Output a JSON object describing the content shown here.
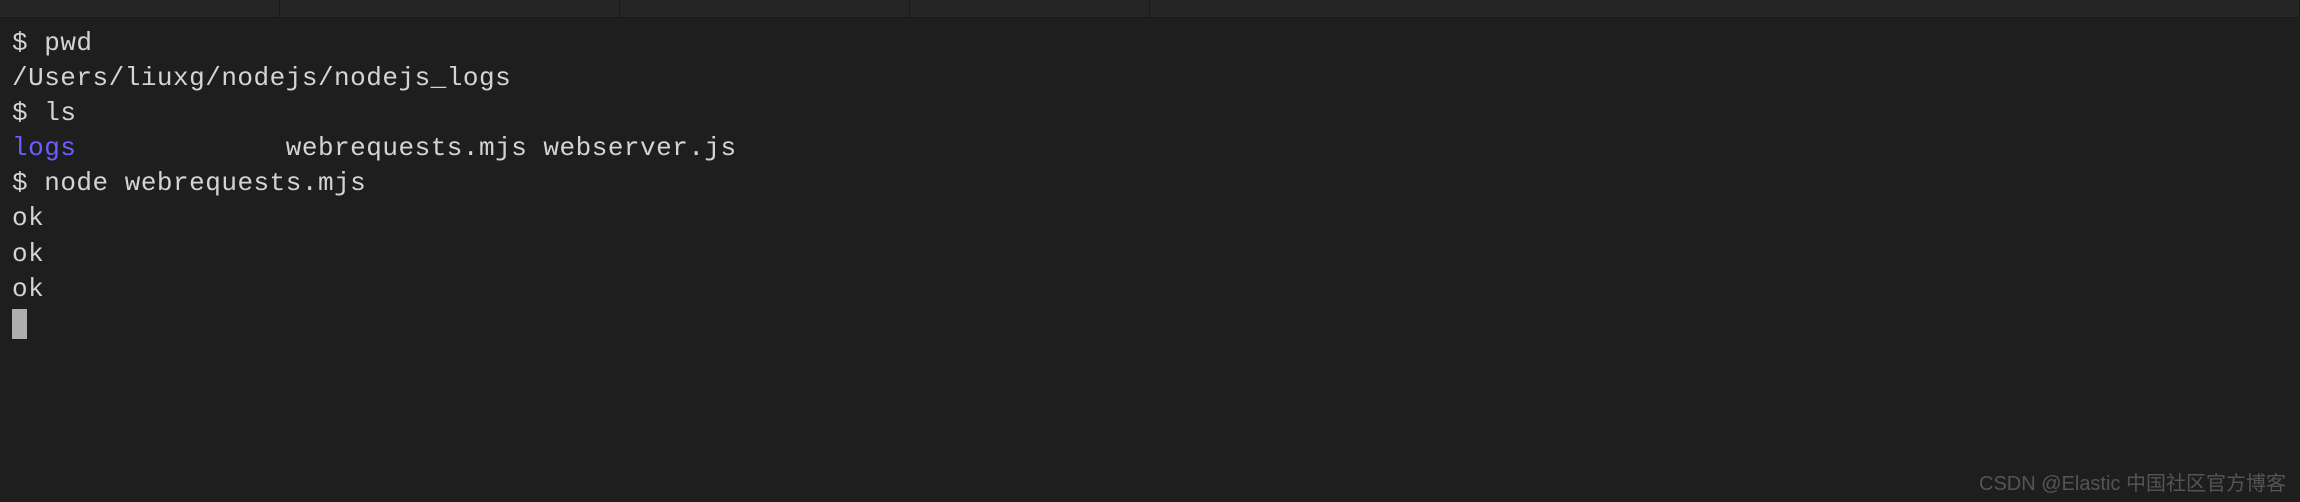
{
  "terminal": {
    "lines": [
      {
        "type": "cmd",
        "prompt": "$ ",
        "text": "pwd"
      },
      {
        "type": "out",
        "text": "/Users/liuxg/nodejs/nodejs_logs"
      },
      {
        "type": "cmd",
        "prompt": "$ ",
        "text": "ls"
      },
      {
        "type": "ls",
        "dir": "logs",
        "spacer": "             ",
        "files": "webrequests.mjs webserver.js"
      },
      {
        "type": "cmd",
        "prompt": "$ ",
        "text": "node webrequests.mjs"
      },
      {
        "type": "out",
        "text": "ok"
      },
      {
        "type": "out",
        "text": "ok"
      },
      {
        "type": "out",
        "text": "ok"
      }
    ]
  },
  "watermark": "CSDN @Elastic 中国社区官方博客"
}
